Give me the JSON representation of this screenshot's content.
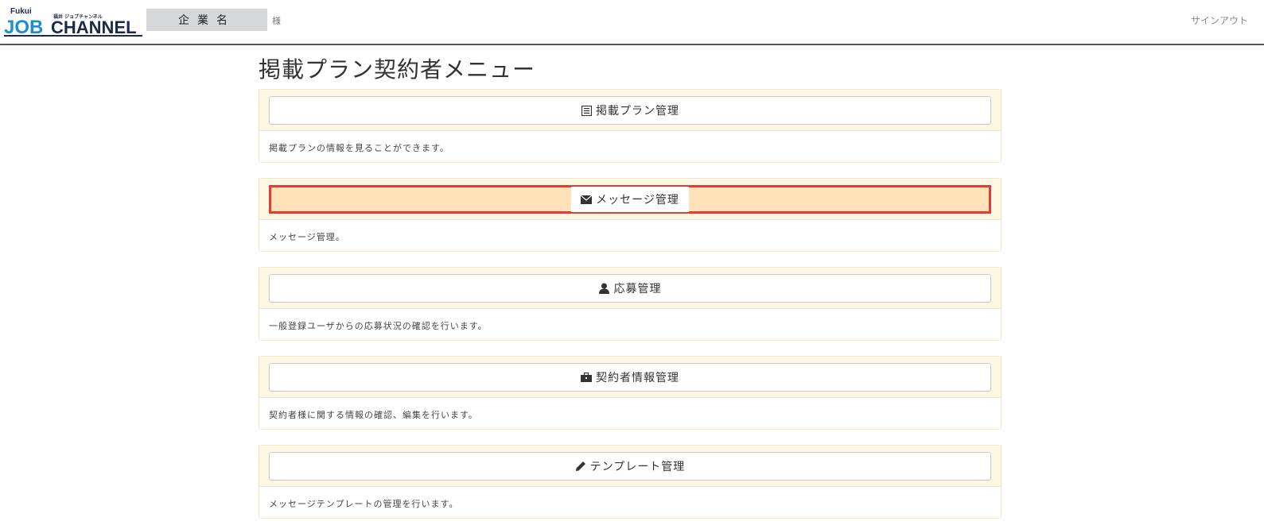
{
  "header": {
    "logo_text_small": "Fukui",
    "logo_text_main": "JOB",
    "logo_text_channel": "CHANNEL",
    "logo_text_sub": "福井 ジョブチャンネル",
    "company_name": "企業名",
    "honorific": "様",
    "signout_label": "サインアウト"
  },
  "page": {
    "title": "掲載プラン契約者メニュー"
  },
  "menu": [
    {
      "icon": "list-alt-icon",
      "label": "掲載プラン管理",
      "description": "掲載プランの情報を見ることができます。"
    },
    {
      "icon": "envelope-icon",
      "label": "メッセージ管理",
      "description": "メッセージ管理。"
    },
    {
      "icon": "user-icon",
      "label": "応募管理",
      "description": "一般登録ユーザからの応募状況の確認を行います。"
    },
    {
      "icon": "briefcase-icon",
      "label": "契約者情報管理",
      "description": "契約者様に関する情報の確認、編集を行います。"
    },
    {
      "icon": "pencil-icon",
      "label": "テンプレート管理",
      "description": "メッセージテンプレートの管理を行います。"
    }
  ],
  "colors": {
    "panel_heading_bg": "#fdf7e3",
    "panel_border": "#f5e6c2",
    "highlight_bg": "#ffe2b7",
    "highlight_border": "#e53b36",
    "logo_blue": "#1a8fd6",
    "logo_dark": "#1b2a4a"
  }
}
